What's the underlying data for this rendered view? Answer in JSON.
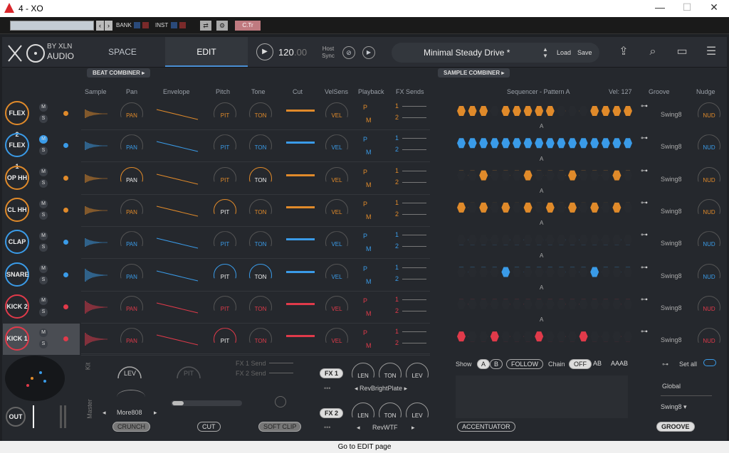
{
  "window": {
    "title": "4 - XO",
    "controls": [
      "—",
      "☐",
      "✕"
    ]
  },
  "host": {
    "bank": "BANK",
    "inst": "INST",
    "ctr": "C.Tr"
  },
  "logo": {
    "by": "BY XLN",
    "audio": "AUDIO"
  },
  "tabs": [
    "SPACE",
    "EDIT"
  ],
  "tempo": {
    "value": "120",
    "fraction": ".00",
    "host_sync": "Host Sync"
  },
  "preset": {
    "name": "Minimal Steady Drive *",
    "load": "Load",
    "save": "Save"
  },
  "combiners": {
    "beat": "BEAT COMBINER",
    "sample": "SAMPLE COMBINER"
  },
  "columns": [
    "Sample",
    "Pan",
    "Envelope",
    "Pitch",
    "Tone",
    "Cut",
    "VelSens",
    "Playback",
    "FX Sends"
  ],
  "seq_header": {
    "title": "Sequencer - Pattern A",
    "vel": "Vel: 127",
    "groove": "Groove",
    "nudge": "Nudge"
  },
  "channels": [
    {
      "name": "FLEX 2",
      "color": "#e08a2a",
      "active": [
        0,
        1,
        2,
        4,
        5,
        6,
        7,
        8,
        12,
        13,
        14,
        15
      ]
    },
    {
      "name": "FLEX 1",
      "color": "#3a9be8",
      "active": [
        0,
        1,
        2,
        3,
        4,
        5,
        6,
        7,
        8,
        9,
        10,
        11,
        12,
        13,
        14,
        15
      ]
    },
    {
      "name": "OP HH",
      "color": "#e08a2a",
      "active": [
        2,
        6,
        10,
        14
      ]
    },
    {
      "name": "CL HH",
      "color": "#e08a2a",
      "active": [
        0,
        2,
        4,
        6,
        8,
        10,
        12,
        14
      ]
    },
    {
      "name": "CLAP",
      "color": "#3a9be8",
      "active": []
    },
    {
      "name": "SNARE",
      "color": "#3a9be8",
      "active": [
        4,
        12
      ]
    },
    {
      "name": "KICK 2",
      "color": "#e03a4a",
      "active": []
    },
    {
      "name": "KICK 1",
      "color": "#e03a4a",
      "active": [
        0,
        3,
        7,
        11
      ]
    }
  ],
  "knobs": {
    "pan": "PAN",
    "pitch": "PIT",
    "tone": "TON",
    "vel": "VEL",
    "nud": "NUD",
    "len": "LEN",
    "lev": "LEV",
    "swing": "Swing8"
  },
  "playback": {
    "p": "P",
    "m": "M",
    "s1": "1",
    "s2": "2"
  },
  "pattern_markers": "A",
  "bottom": {
    "kit": "Kit",
    "master": "Master",
    "fx1send": "FX 1 Send",
    "fx2send": "FX 2 Send",
    "more808": "More808",
    "crunch": "CRUNCH",
    "cut": "CUT",
    "softclip": "SOFT CLIP",
    "fx1": "FX 1",
    "fx2": "FX 2",
    "fx1_preset": "RevBrightPlate",
    "fx2_preset": "RevWTF",
    "show": "Show",
    "a": "A",
    "b": "B",
    "follow": "FOLLOW",
    "chain": "Chain",
    "off": "OFF",
    "ab": "AB",
    "aaab": "AAAB",
    "accentuator": "ACCENTUATOR",
    "setall": "Set all",
    "global": "Global",
    "groove_btn": "GROOVE",
    "out": "OUT"
  },
  "status": "Go to EDIT page"
}
